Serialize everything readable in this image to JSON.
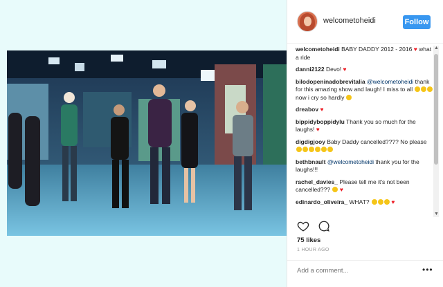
{
  "header": {
    "username": "welcometoheidi",
    "follow_label": "Follow"
  },
  "comments": [
    {
      "user": "welcometoheidi",
      "text": "BABY DADDY 2012 - 2016",
      "suffix": "what a ride"
    },
    {
      "user": "danni2122",
      "text": "Devo!"
    },
    {
      "user": "bilodopeninadobrevitalia",
      "mention": "@welcometoheidi",
      "text": "thank for this amazing show and laugh! I miss to all",
      "suffix": "now i cry so hardly"
    },
    {
      "user": "dreabov",
      "text": ""
    },
    {
      "user": "bippidyboppidylu",
      "text": "Thank you so much for the laughs!"
    },
    {
      "user": "digdigjooy",
      "text": "Baby Daddy cancelled???? No please"
    },
    {
      "user": "bethbnault",
      "mention": "@welcometoheidi",
      "text": "thank you for the laughs!!!"
    },
    {
      "user": "rachel_davies_",
      "text": "Please tell me it's not been cancelled???"
    },
    {
      "user": "edinardo_oliveira_",
      "text": "WHAT?"
    }
  ],
  "likes": "75 likes",
  "time": "1 HOUR AGO",
  "add_comment_placeholder": "Add a comment...",
  "colors": {
    "follow": "#3897f0",
    "heart": "#ed1c24",
    "mention": "#003569"
  },
  "icons": [
    "heart-outline-icon",
    "comment-bubble-icon",
    "more-options-icon"
  ]
}
